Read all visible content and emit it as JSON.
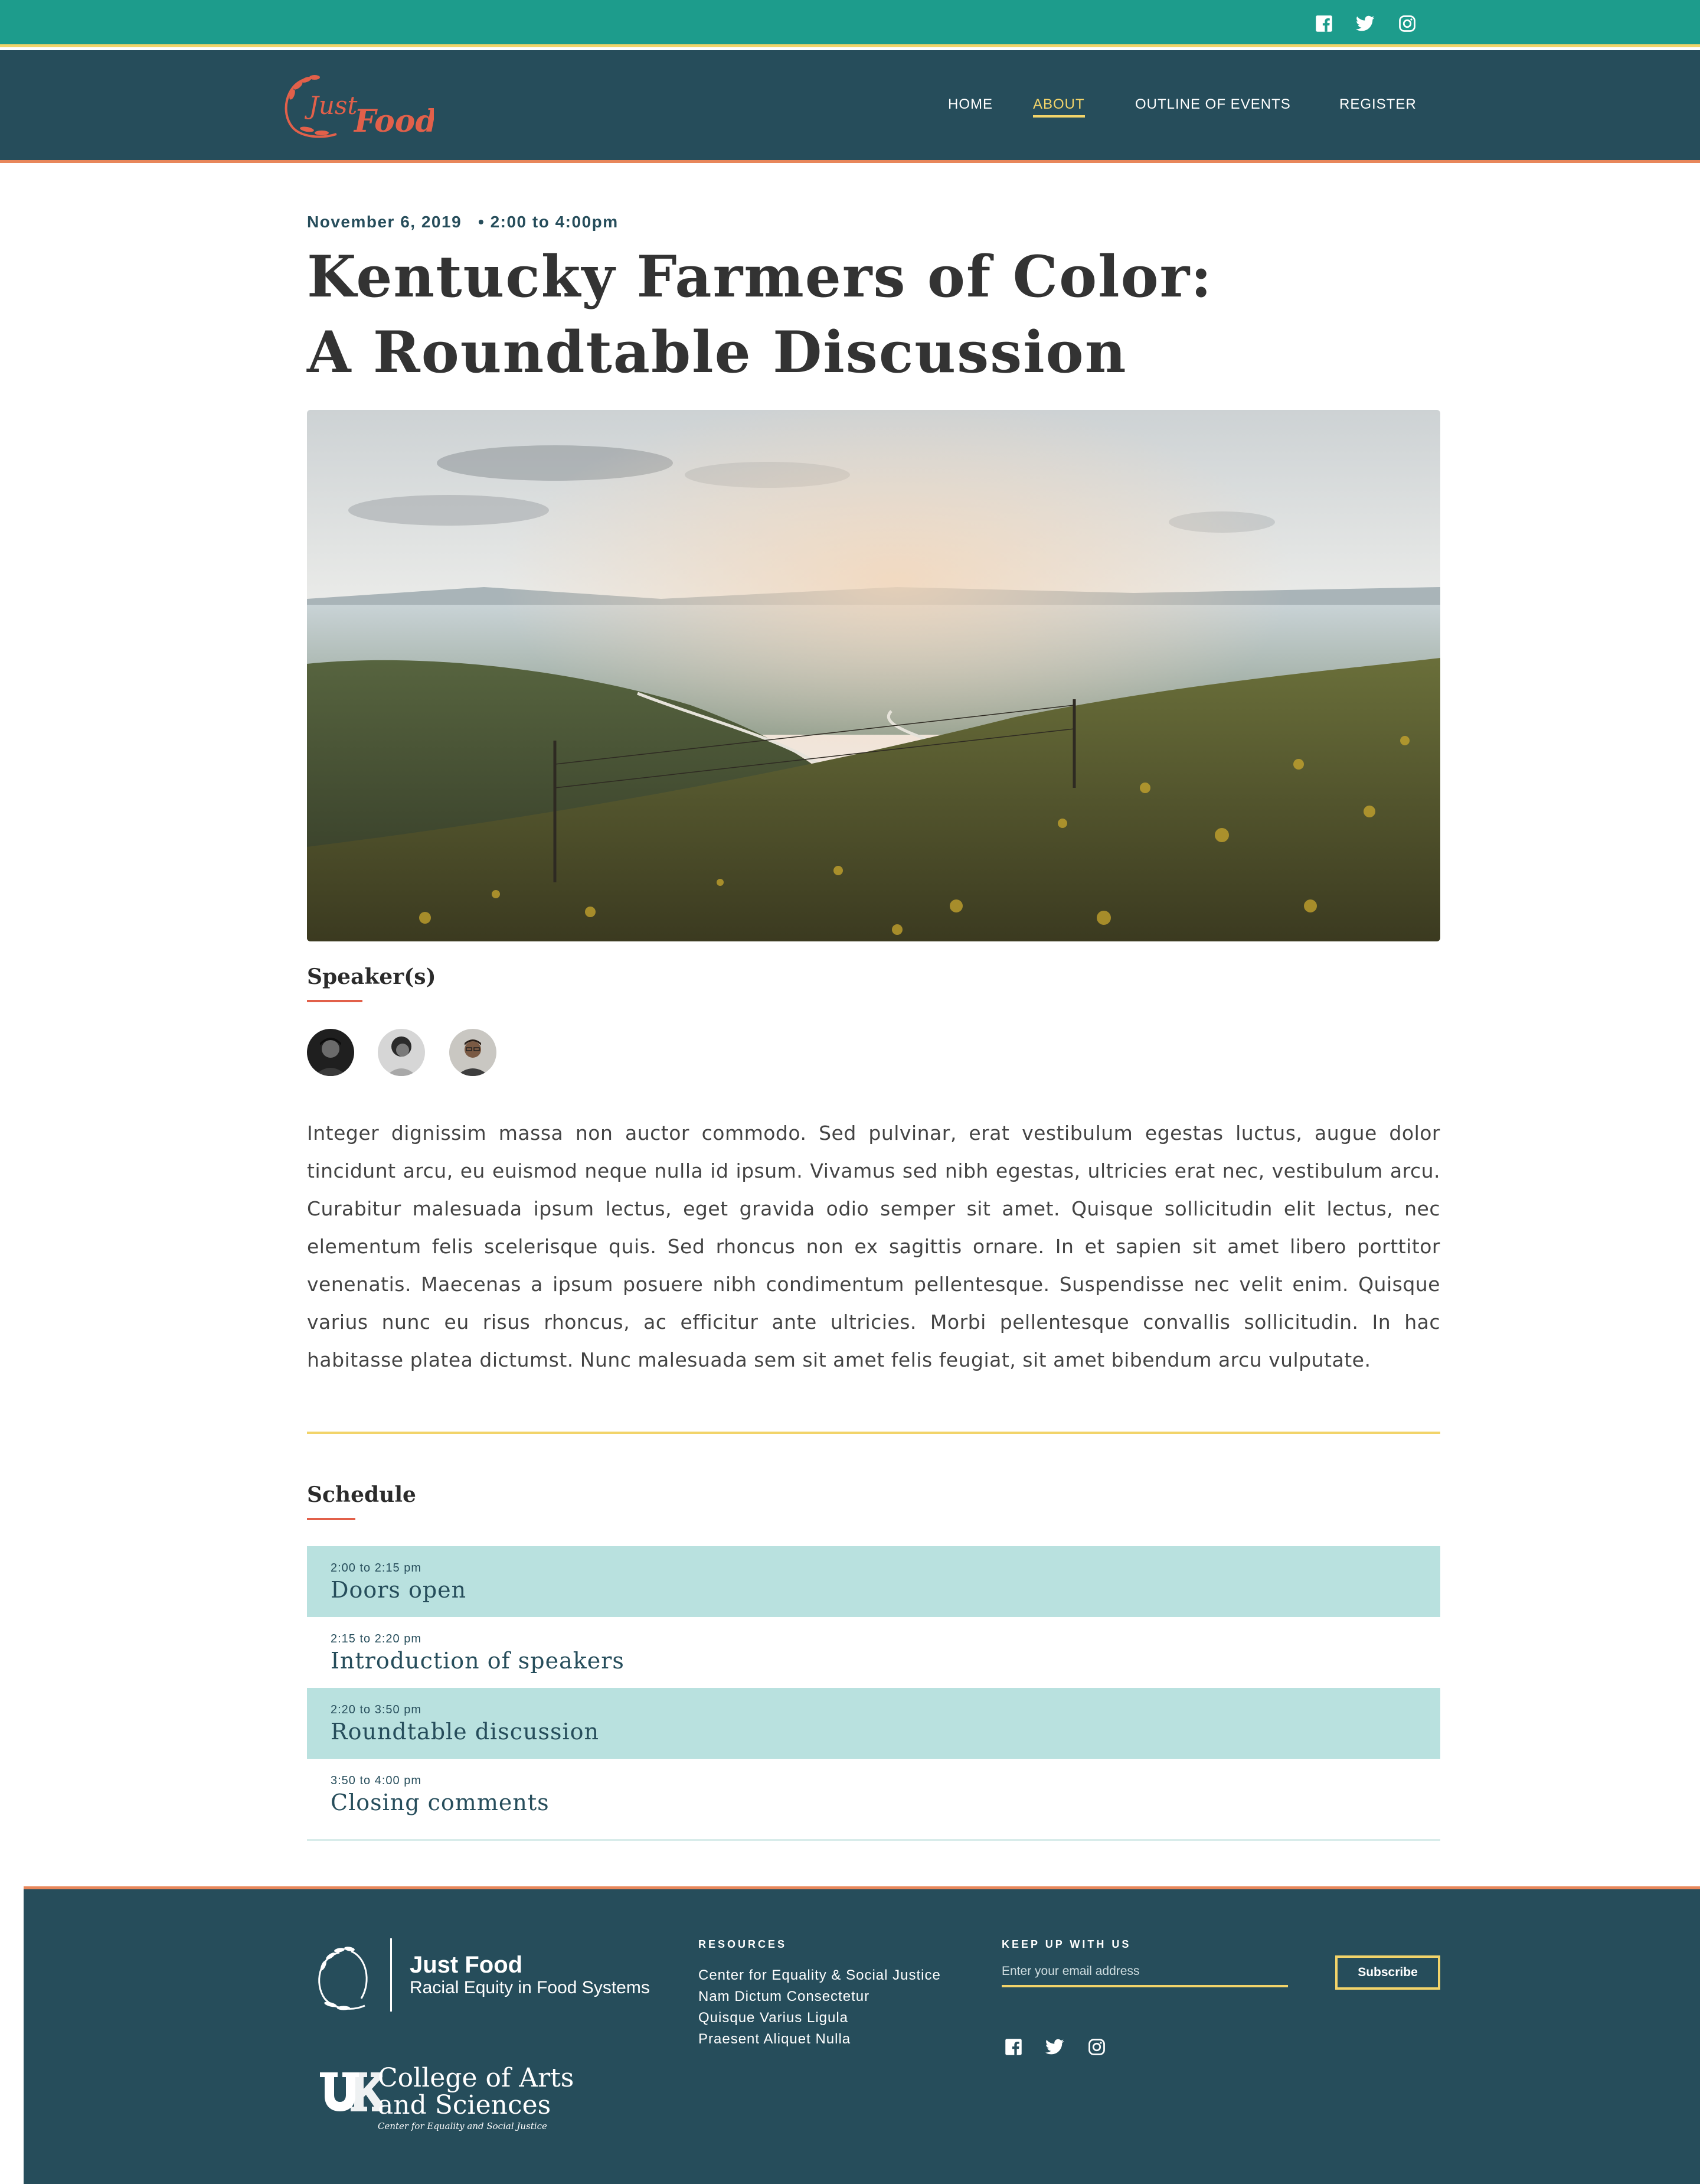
{
  "top_bar": {
    "social_icons": [
      "facebook-icon",
      "twitter-icon",
      "instagram-icon"
    ],
    "background": "#1d9c8c"
  },
  "header": {
    "logo_text": [
      "Just",
      "Food"
    ],
    "nav": [
      {
        "label": "HOME",
        "active": false
      },
      {
        "label": "ABOUT",
        "active": true
      },
      {
        "label": "OUTLINE OF EVENTS",
        "active": false
      },
      {
        "label": "REGISTER",
        "active": false
      }
    ],
    "background": "#264d5b",
    "accent": "#f2d46a"
  },
  "event": {
    "date": "November 6, 2019",
    "time": "2:00 to 4:00pm",
    "title": "Kentucky Farmers of Color: A Roundtable Discussion",
    "speakers_heading": "Speaker(s)",
    "speaker_count": 3,
    "description": "Integer dignissim massa non auctor commodo. Sed pulvinar, erat vestibulum egestas luctus, augue dolor tincidunt arcu, eu euismod neque nulla id ipsum. Vivamus sed nibh egestas, ultricies erat nec, vestibulum arcu. Curabitur malesuada ipsum lectus, eget gravida odio semper sit amet. Quisque sollicitudin elit lectus, nec elementum felis scelerisque quis. Sed rhoncus non ex sagittis ornare. In et sapien sit amet libero porttitor venenatis. Maecenas a ipsum posuere nibh condimentum pellentesque. Suspendisse nec velit enim. Quisque varius nunc eu risus rhoncus, ac efficitur ante ultricies. Morbi pellentesque convallis sollicitudin. In hac habitasse platea dictumst. Nunc malesuada sem sit amet felis feugiat, sit amet bibendum arcu vulputate."
  },
  "schedule": {
    "heading": "Schedule",
    "items": [
      {
        "time": "2:00 to 2:15 pm",
        "label": "Doors open"
      },
      {
        "time": "2:15 to 2:20 pm",
        "label": "Introduction of speakers"
      },
      {
        "time": "2:20 to 3:50 pm",
        "label": "Roundtable discussion"
      },
      {
        "time": "3:50 to 4:00 pm",
        "label": "Closing comments"
      }
    ],
    "highlight_color": "#b9e1df"
  },
  "footer": {
    "brand_name": "Just Food",
    "brand_subtitle": "Racial Equity in Food Systems",
    "college_line1": "College of Arts",
    "college_line2": "and Sciences",
    "college_sub": "Center for Equality and Social Justice",
    "resources_heading": "RESOURCES",
    "resources": [
      "Center for Equality & Social Justice",
      "Nam Dictum Consectetur",
      "Quisque Varius Ligula",
      "Praesent Aliquet Nulla"
    ],
    "newsletter_heading": "KEEP UP WITH US",
    "email_placeholder": "Enter your email address",
    "subscribe_label": "Subscribe",
    "social_icons": [
      "facebook-icon",
      "twitter-icon",
      "instagram-icon"
    ]
  }
}
